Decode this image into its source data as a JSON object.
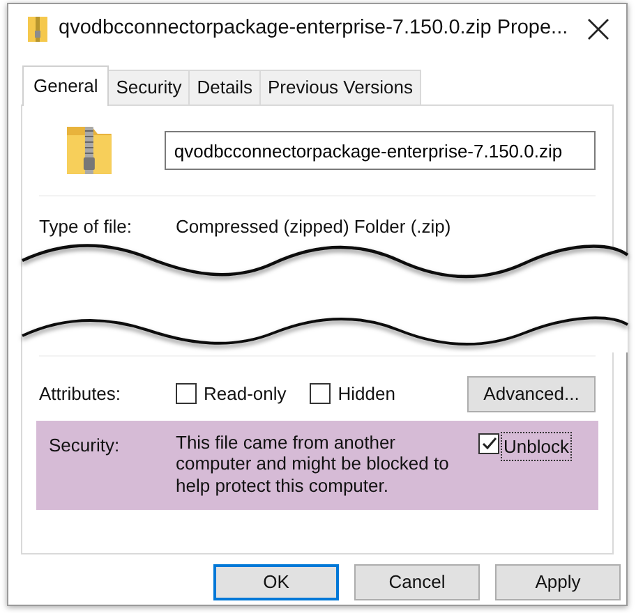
{
  "window": {
    "title": "qvodbcconnectorpackage-enterprise-7.150.0.zip Prope..."
  },
  "tabs": [
    {
      "label": "General",
      "selected": true
    },
    {
      "label": "Security",
      "selected": false
    },
    {
      "label": "Details",
      "selected": false
    },
    {
      "label": "Previous Versions",
      "selected": false
    }
  ],
  "file": {
    "name": "qvodbcconnectorpackage-enterprise-7.150.0.zip"
  },
  "properties": [
    {
      "label": "Type of file:",
      "value": "Compressed (zipped) Folder (.zip)"
    }
  ],
  "attributes": {
    "label": "Attributes:",
    "options": [
      {
        "label": "Read-only",
        "checked": false
      },
      {
        "label": "Hidden",
        "checked": false
      }
    ],
    "button": "Advanced..."
  },
  "security": {
    "label": "Security:",
    "highlighted": true,
    "message": "This file came from another computer and might be blocked to help protect this computer.",
    "unblock": {
      "label": "Unblock",
      "checked": true
    }
  },
  "buttons": [
    {
      "label": "OK",
      "default": true
    },
    {
      "label": "Cancel",
      "default": false
    },
    {
      "label": "Apply",
      "default": false
    }
  ]
}
